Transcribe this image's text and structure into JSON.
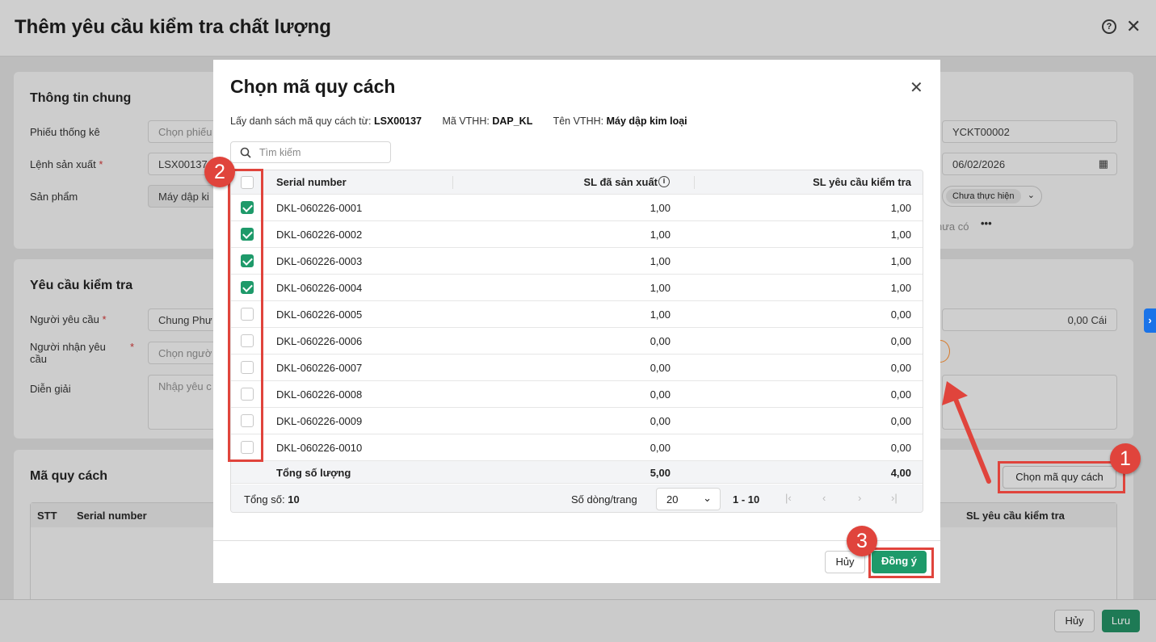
{
  "window": {
    "title": "Thêm yêu cầu kiểm tra chất lượng"
  },
  "general": {
    "title": "Thông tin chung",
    "phieu_label": "Phiếu thống kê",
    "phieu_ph": "Chọn phiếu",
    "lenh_label": "Lệnh sản xuất",
    "lenh_value": "LSX00137",
    "sp_label": "Sản phẩm",
    "sp_value": "Máy dập ki",
    "code": "YCKT00002",
    "date": "06/02/2026",
    "status": "Chưa thực hiện",
    "chua_co": "hưa có"
  },
  "request": {
    "title": "Yêu cầu kiểm tra",
    "nguoi_yc_label": "Người yêu cầu",
    "nguoi_yc_value": "Chung Phư",
    "nguoi_nhan_label": "Người nhận yêu cầu",
    "nguoi_nhan_ph": "Chọn ngườ",
    "dien_giai_label": "Diễn giải",
    "dien_giai_ph": "Nhập yêu c",
    "qty": "0,00 Cái"
  },
  "spec": {
    "title": "Mã quy cách",
    "choose_btn": "Chọn mã quy cách",
    "cols": [
      "STT",
      "Serial number",
      "SL yêu cầu kiểm tra"
    ]
  },
  "footer": {
    "cancel": "Hủy",
    "save": "Lưu"
  },
  "modal": {
    "title": "Chọn mã quy cách",
    "info_from_label": "Lấy danh sách mã quy cách từ:",
    "info_from": "LSX00137",
    "info_code_label": "Mã VTHH:",
    "info_code": "DAP_KL",
    "info_name_label": "Tên VTHH:",
    "info_name": "Máy dập kim loại",
    "search_ph": "Tìm kiếm",
    "headers": [
      "Serial number",
      "SL đã sản xuất",
      "SL yêu cầu kiểm tra"
    ],
    "rows": [
      {
        "sn": "DKL-060226-0001",
        "q1": "1,00",
        "q2": "1,00",
        "checked": true
      },
      {
        "sn": "DKL-060226-0002",
        "q1": "1,00",
        "q2": "1,00",
        "checked": true
      },
      {
        "sn": "DKL-060226-0003",
        "q1": "1,00",
        "q2": "1,00",
        "checked": true
      },
      {
        "sn": "DKL-060226-0004",
        "q1": "1,00",
        "q2": "1,00",
        "checked": true
      },
      {
        "sn": "DKL-060226-0005",
        "q1": "1,00",
        "q2": "0,00",
        "checked": false
      },
      {
        "sn": "DKL-060226-0006",
        "q1": "0,00",
        "q2": "0,00",
        "checked": false
      },
      {
        "sn": "DKL-060226-0007",
        "q1": "0,00",
        "q2": "0,00",
        "checked": false
      },
      {
        "sn": "DKL-060226-0008",
        "q1": "0,00",
        "q2": "0,00",
        "checked": false
      },
      {
        "sn": "DKL-060226-0009",
        "q1": "0,00",
        "q2": "0,00",
        "checked": false
      },
      {
        "sn": "DKL-060226-0010",
        "q1": "0,00",
        "q2": "0,00",
        "checked": false
      }
    ],
    "total_label": "Tổng số lượng",
    "total_q1": "5,00",
    "total_q2": "4,00",
    "count_label": "Tổng số:",
    "count": "10",
    "per_page_label": "Số dòng/trang",
    "per_page": "20",
    "range": "1 - 10",
    "cancel": "Hủy",
    "ok": "Đồng ý"
  },
  "annotations": [
    "1",
    "2",
    "3"
  ]
}
